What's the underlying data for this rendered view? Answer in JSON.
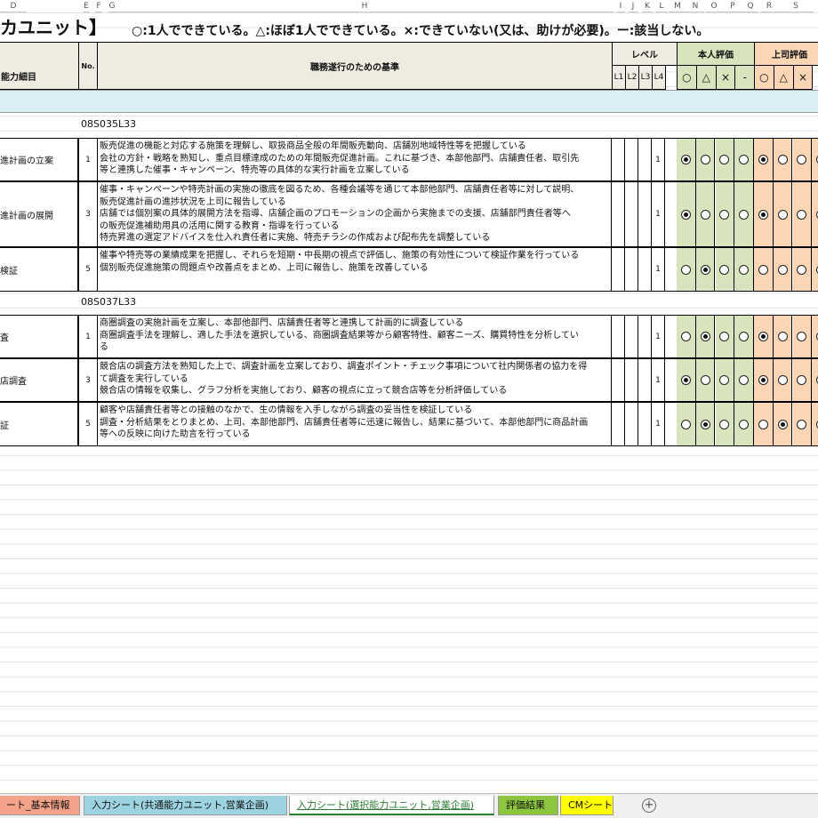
{
  "columns": [
    "D",
    "E",
    "F",
    "G",
    "H",
    "I",
    "J",
    "K",
    "L",
    "M",
    "N",
    "O",
    "P",
    "Q",
    "R",
    "S"
  ],
  "title": "カユニット】",
  "legend": "○:1人でできている。△:ほぼ1人でできている。×:できていない(又は、助けが必要)。ー:該当しない。",
  "header": {
    "skill_detail": "能力細目",
    "no": "No.",
    "criteria": "職務遂行のための基準",
    "level": "レベル",
    "levels": [
      "L1",
      "L2",
      "L3",
      "L4"
    ],
    "self_eval": "本人評価",
    "boss_eval": "上司評価",
    "marks": [
      "○",
      "△",
      "×",
      "-"
    ],
    "boss_marks": [
      "○",
      "△",
      "×"
    ]
  },
  "groups": [
    {
      "code": "08S035L33",
      "rows": [
        {
          "name": "進計画の立案",
          "no": "1",
          "level": "1",
          "self": 0,
          "boss": 0,
          "lines": [
            "販売促進の機能と対応する施策を理解し、取扱商品全般の年間販売動向、店舗別地域特性等を把握している",
            "会社の方針・戦略を熟知し、重点目標達成のための年間販売促進計画。これに基づき、本部他部門、店舗責任者、取引先",
            "等と連携した催事・キャンペーン、特売等の具体的な実行計画を立案している"
          ]
        },
        {
          "name": "進計画の展開",
          "no": "3",
          "level": "1",
          "self": 0,
          "boss": 0,
          "lines": [
            "催事・キャンペーンや特売計画の実施の徹底を図るため、各種会議等を通じて本部他部門、店舗責任者等に対して説明、",
            "販売促進計画の進捗状況を上司に報告している",
            "店舗では個別案の具体的展開方法を指導、店舗企画のプロモーションの企画から実施までの支援、店舗部門責任者等へ",
            "の販売促進補助用具の活用に関する教育・指導を行っている",
            "特売昇進の選定アドバイスを仕入れ責任者に実施、特売チラシの作成および配布先を調整している"
          ]
        },
        {
          "name": "検証",
          "no": "5",
          "level": "1",
          "self": 1,
          "boss": -1,
          "lines": [
            "催事や特売等の業績成果を把握し、それらを短期・中長期の視点で評価し、施策の有効性について検証作業を行っている",
            "個別販売促進施策の問題点や改善点をまとめ、上司に報告し、施策を改善している"
          ]
        }
      ]
    },
    {
      "code": "08S037L33",
      "rows": [
        {
          "name": "査",
          "no": "1",
          "level": "1",
          "self": 1,
          "boss": 0,
          "lines": [
            "商圏調査の実施計画を立案し、本部他部門、店舗責任者等と連携して計画的に調査している",
            "商圏調査手法を理解し、適した手法を選択している、商圏調査結果等から顧客特性、顧客ニーズ、購買特性を分析してい",
            "る"
          ]
        },
        {
          "name": "店調査",
          "no": "3",
          "level": "1",
          "self": 0,
          "boss": 0,
          "lines": [
            "競合店の調査方法を熟知した上で、調査計画を立案しており、調査ポイント・チェック事項について社内関係者の協力を得",
            "て調査を実行している",
            "競合店の情報を収集し、グラフ分析を実施しており、顧客の視点に立って競合店等を分析評価している"
          ]
        },
        {
          "name": "証",
          "no": "5",
          "level": "1",
          "self": 1,
          "boss": 1,
          "lines": [
            "顧客や店舗責任者等との接触のなかで、生の情報を入手しながら調査の妥当性を検証している",
            "調査・分析結果をとりまとめ、上司、本部他部門、店舗責任者等に迅速に報告し、結果に基づいて、本部他部門に商品計画",
            "等への反映に向けた助言を行っている"
          ]
        }
      ]
    }
  ],
  "tabs": [
    {
      "label": "ート_基本情報",
      "color": "#f4a38a"
    },
    {
      "label": "入力シート(共通能力ユニット,営業企画)",
      "color": "#9dd3e0"
    },
    {
      "label": "入力シート(選択能力ユニット,営業企画)",
      "color": "#ffffff"
    },
    {
      "label": "評価結果",
      "color": "#8cc63f"
    },
    {
      "label": "CMシート",
      "color": "#ffff00"
    }
  ],
  "add_sheet_icon": "plus-circle-icon"
}
